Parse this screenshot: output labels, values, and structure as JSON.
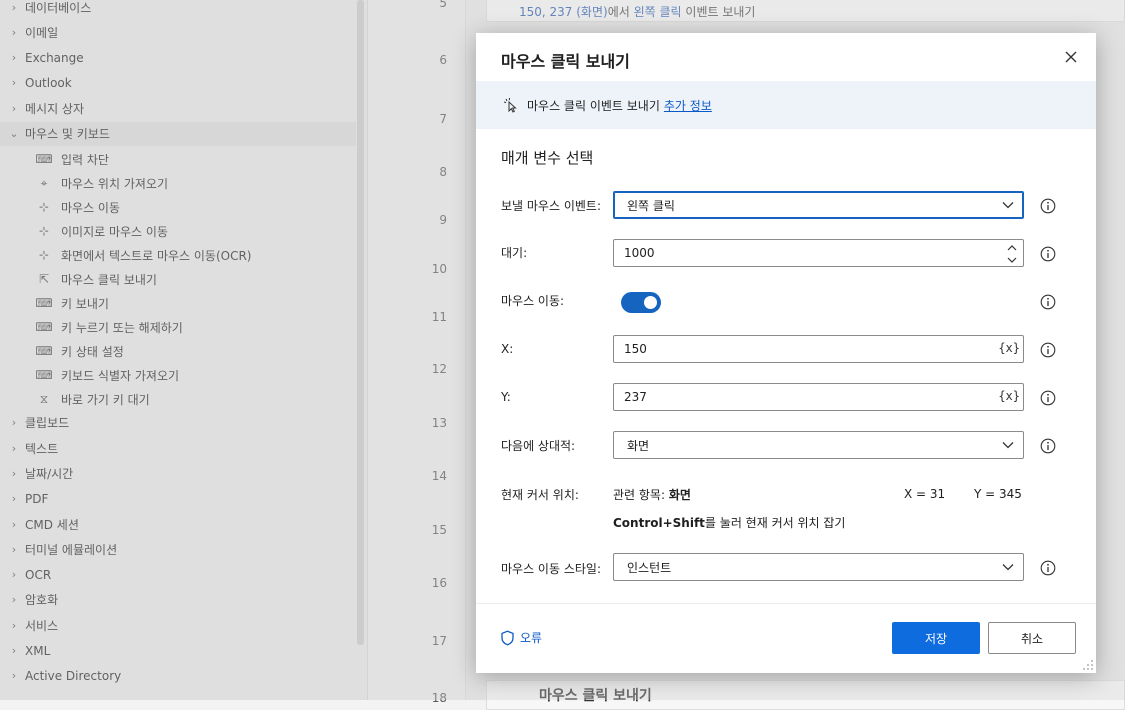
{
  "sidebar": {
    "items": [
      {
        "label": "데이터베이스",
        "expanded": false
      },
      {
        "label": "이메일",
        "expanded": false
      },
      {
        "label": "Exchange",
        "expanded": false
      },
      {
        "label": "Outlook",
        "expanded": false
      },
      {
        "label": "메시지 상자",
        "expanded": false
      },
      {
        "label": "마우스 및 키보드",
        "expanded": true
      },
      {
        "label": "클립보드",
        "expanded": false
      },
      {
        "label": "텍스트",
        "expanded": false
      },
      {
        "label": "날짜/시간",
        "expanded": false
      },
      {
        "label": "PDF",
        "expanded": false
      },
      {
        "label": "CMD 세션",
        "expanded": false
      },
      {
        "label": "터미널 에뮬레이션",
        "expanded": false
      },
      {
        "label": "OCR",
        "expanded": false
      },
      {
        "label": "암호화",
        "expanded": false
      },
      {
        "label": "서비스",
        "expanded": false
      },
      {
        "label": "XML",
        "expanded": false
      },
      {
        "label": "Active Directory",
        "expanded": false
      }
    ],
    "children": [
      {
        "label": "입력 차단",
        "icon": "keyboard-icon"
      },
      {
        "label": "마우스 위치 가져오기",
        "icon": "crosshair-icon"
      },
      {
        "label": "마우스 이동",
        "icon": "mouse-move-icon"
      },
      {
        "label": "이미지로 마우스 이동",
        "icon": "mouse-move-icon"
      },
      {
        "label": "화면에서 텍스트로 마우스 이동(OCR)",
        "icon": "mouse-move-icon"
      },
      {
        "label": "마우스 클릭 보내기",
        "icon": "mouse-click-icon"
      },
      {
        "label": "키 보내기",
        "icon": "keyboard-icon"
      },
      {
        "label": "키 누르기 또는 해제하기",
        "icon": "keyboard-icon"
      },
      {
        "label": "키 상태 설정",
        "icon": "keyboard-icon"
      },
      {
        "label": "키보드 식별자 가져오기",
        "icon": "keyboard-icon"
      },
      {
        "label": "바로 가기 키 대기",
        "icon": "hourglass-icon"
      }
    ]
  },
  "gutter": {
    "line_numbers": [
      "5",
      "6",
      "7",
      "8",
      "9",
      "10",
      "11",
      "12",
      "13",
      "14",
      "15",
      "16",
      "17",
      "18"
    ]
  },
  "canvas": {
    "top_step": {
      "coords": "150, 237 (화면)",
      "text1": "에서 ",
      "highlight": "왼쪽 클릭",
      "text2": " 이벤트 보내기"
    },
    "bottom_step": {
      "title": "마우스 클릭 보내기"
    }
  },
  "dialog": {
    "title": "마우스 클릭 보내기",
    "banner": {
      "text": "마우스 클릭 이벤트 보내기",
      "link": "추가 정보"
    },
    "section_title": "매개 변수 선택",
    "fields": {
      "event": {
        "label": "보낼 마우스 이벤트:",
        "value": "왼쪽 클릭"
      },
      "wait": {
        "label": "대기:",
        "value": "1000"
      },
      "move": {
        "label": "마우스 이동:",
        "enabled": true
      },
      "x": {
        "label": "X:",
        "value": "150",
        "var_button": "{x}"
      },
      "y": {
        "label": "Y:",
        "value": "237",
        "var_button": "{x}"
      },
      "relative": {
        "label": "다음에 상대적:",
        "value": "화면"
      },
      "cursor": {
        "label": "현재 커서 위치:",
        "related_prefix": "관련 항목: ",
        "related_value": "화면",
        "x_readout": "X = 31",
        "y_readout": "Y = 345",
        "hint_keys": "Control+Shift",
        "hint_rest": "를 눌러 현재 커서 위치 잡기"
      },
      "style": {
        "label": "마우스 이동 스타일:",
        "value": "인스턴트"
      }
    },
    "footer": {
      "error_label": "오류",
      "save_label": "저장",
      "cancel_label": "취소"
    },
    "accent_color": "#0f6cde"
  }
}
